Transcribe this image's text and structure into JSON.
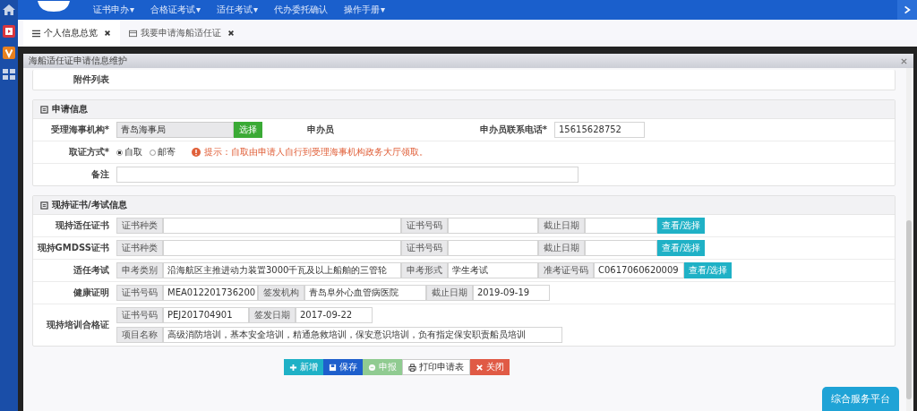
{
  "nav": [
    {
      "label": "证书申办",
      "caret": "▾"
    },
    {
      "label": "合格证考试",
      "caret": "▾"
    },
    {
      "label": "适任考试",
      "caret": "▾"
    },
    {
      "label": "代办委托确认"
    },
    {
      "label": "操作手册",
      "caret": "▾"
    }
  ],
  "tabs": [
    {
      "label": "个人信息总览",
      "selected": true
    },
    {
      "label": "我要申请海船适任证",
      "selected": false
    }
  ],
  "dialog": {
    "title": "海船适任证申请信息维护",
    "attachments_label": "附件列表"
  },
  "apply": {
    "title": "申请信息",
    "agency_label": "受理海事机构*",
    "agency_value": "青岛海事局",
    "agency_button": "选择",
    "handler_label": "申办员",
    "phone_label": "申办员联系电话*",
    "phone_value": "15615628752",
    "method_label": "取证方式*",
    "methods": [
      {
        "label": "自取",
        "selected": true
      },
      {
        "label": "邮寄",
        "selected": false
      }
    ],
    "hint": "提示：自取由申请人自行到受理海事机构政务大厅领取。",
    "remark_label": "备注"
  },
  "certs": {
    "title": "现持证书/考试信息",
    "rows": [
      {
        "label": "现持适任证书",
        "lines": [
          [
            {
              "addon": "证书种类"
            },
            {
              "addon": "证书号码"
            },
            {
              "addon": "截止日期"
            }
          ]
        ],
        "button": "查看/选择"
      },
      {
        "label": "现持GMDSS证书",
        "lines": [
          [
            {
              "addon": "证书种类"
            },
            {
              "addon": "证书号码"
            },
            {
              "addon": "截止日期"
            }
          ]
        ],
        "button": "查看/选择"
      },
      {
        "label": "适任考试",
        "lines": [
          [
            {
              "addon": "申考类别",
              "value": "沿海航区主推进动力装置3000千瓦及以上船舶的三管轮"
            },
            {
              "addon": "申考形式",
              "value": "学生考试"
            },
            {
              "addon": "准考证号码",
              "value": "C0617060620009"
            }
          ]
        ],
        "button": "查看/选择"
      },
      {
        "label": "健康证明",
        "lines": [
          [
            {
              "addon": "证书号码",
              "value": "MEA012201736200"
            },
            {
              "addon": "签发机构",
              "value": "青岛阜外心血管病医院"
            },
            {
              "addon": "截止日期",
              "value": "2019-09-19"
            }
          ]
        ]
      },
      {
        "label": "现持培训合格证",
        "lines": [
          [
            {
              "addon": "证书号码",
              "value": "PEJ201704901"
            },
            {
              "addon": "签发日期",
              "value": "2017-09-22"
            }
          ],
          [
            {
              "addon": "项目名称",
              "value": "高级消防培训，基本安全培训，精通急救培训，保安意识培训，负有指定保安职责船员培训"
            }
          ]
        ]
      }
    ]
  },
  "actions": [
    {
      "kind": "add",
      "label": "新增",
      "disabled": false
    },
    {
      "kind": "save",
      "label": "保存",
      "disabled": false
    },
    {
      "kind": "submit",
      "label": "申报",
      "disabled": true
    },
    {
      "kind": "print",
      "label": "打印申请表",
      "disabled": false
    },
    {
      "kind": "close",
      "label": "关闭",
      "disabled": false
    }
  ],
  "float_button": "综合服务平台"
}
